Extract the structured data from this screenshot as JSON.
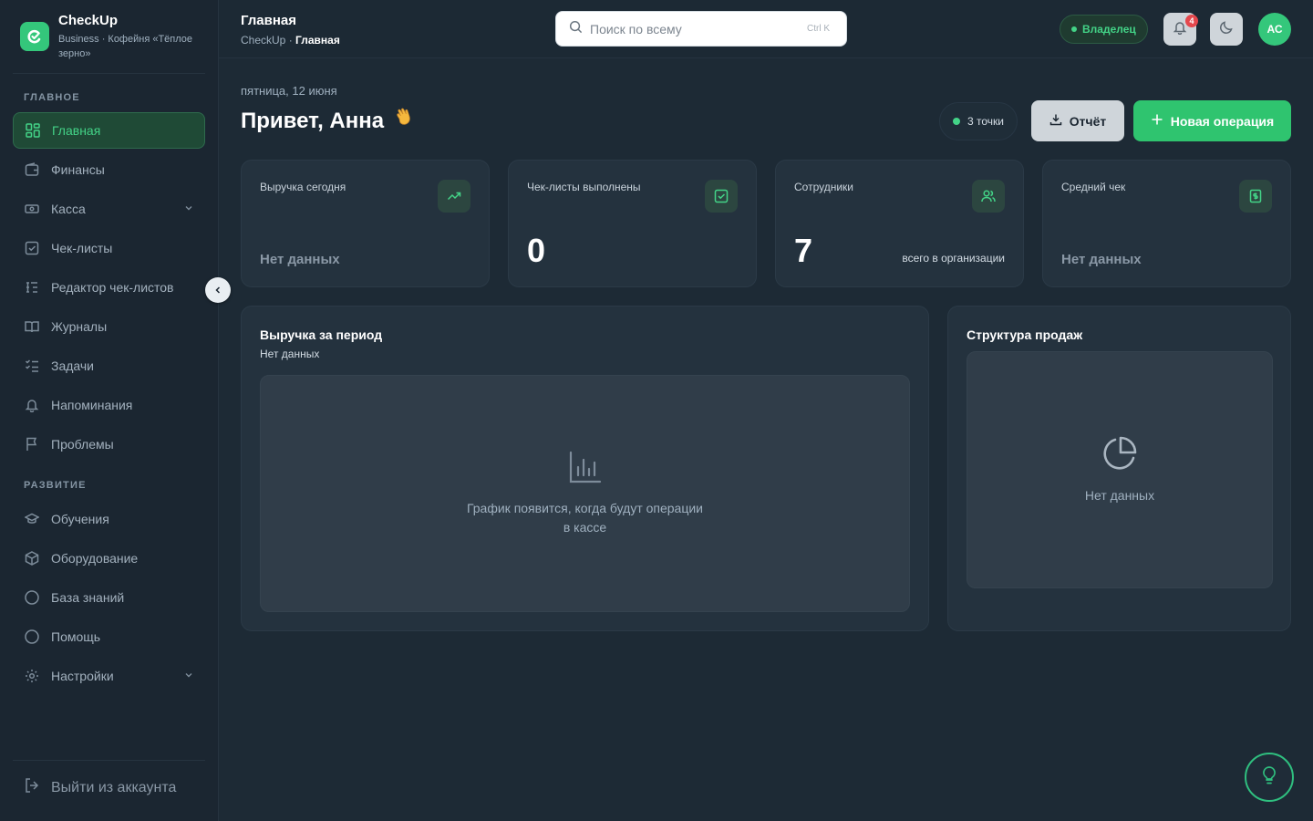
{
  "brand": {
    "name": "CheckUp",
    "subtitle": "Business · Кофейня «Тёплое зерно»"
  },
  "sidebar": {
    "section_main": "ГЛАВНОЕ",
    "section_dev": "РАЗВИТИЕ",
    "items": [
      {
        "label": "Главная",
        "icon": "grid-icon",
        "active": true
      },
      {
        "label": "Финансы",
        "icon": "wallet-icon"
      },
      {
        "label": "Касса",
        "icon": "cash-icon",
        "expandable": true
      },
      {
        "label": "Чек-листы",
        "icon": "checklist-icon"
      },
      {
        "label": "Редактор чек-листов",
        "icon": "list-edit-icon"
      },
      {
        "label": "Журналы",
        "icon": "book-icon"
      },
      {
        "label": "Задачи",
        "icon": "tasks-icon"
      },
      {
        "label": "Напоминания",
        "icon": "bell-icon"
      },
      {
        "label": "Проблемы",
        "icon": "flag-icon"
      },
      {
        "label": "Обучения",
        "icon": "graduation-icon"
      },
      {
        "label": "Оборудование",
        "icon": "box-icon"
      },
      {
        "label": "База знаний",
        "icon": "circle-icon"
      },
      {
        "label": "Помощь",
        "icon": "help-circle-icon"
      },
      {
        "label": "Настройки",
        "icon": "gear-icon",
        "expandable": true
      }
    ],
    "logout": "Выйти из аккаунта"
  },
  "header": {
    "title": "Главная",
    "breadcrumb_root": "CheckUp · ",
    "breadcrumb_current": "Главная",
    "search_placeholder": "Поиск по всему",
    "search_shortcut": "Ctrl K",
    "role": "Владелец",
    "notifications_count": "4",
    "avatar_initials": "АС"
  },
  "main": {
    "date": "пятница, 12 июня",
    "greeting": "Привет, Анна",
    "greeting_emoji": "👋",
    "points": "3 точки",
    "report_label": "Отчёт",
    "new_operation_label": "Новая операция",
    "stats": [
      {
        "label": "Выручка сегодня",
        "icon": "trending-up-icon",
        "value": "Нет данных",
        "kind": "nodata"
      },
      {
        "label": "Чек-листы выполнены",
        "icon": "check-square-icon",
        "value": "0",
        "kind": "big"
      },
      {
        "label": "Сотрудники",
        "icon": "users-icon",
        "value": "7",
        "kind": "big",
        "note": "всего в организации"
      },
      {
        "label": "Средний чек",
        "icon": "receipt-icon",
        "value": "Нет данных",
        "kind": "nodata"
      }
    ],
    "revenue_panel": {
      "title": "Выручка за период",
      "subtitle": "Нет данных",
      "empty_line1": "График появится, когда будут операции",
      "empty_line2": "в кассе"
    },
    "structure_panel": {
      "title": "Структура продаж",
      "empty": "Нет данных"
    }
  },
  "colors": {
    "accent": "#2fc46f",
    "background": "#1d2a35",
    "card": "#24323e"
  }
}
